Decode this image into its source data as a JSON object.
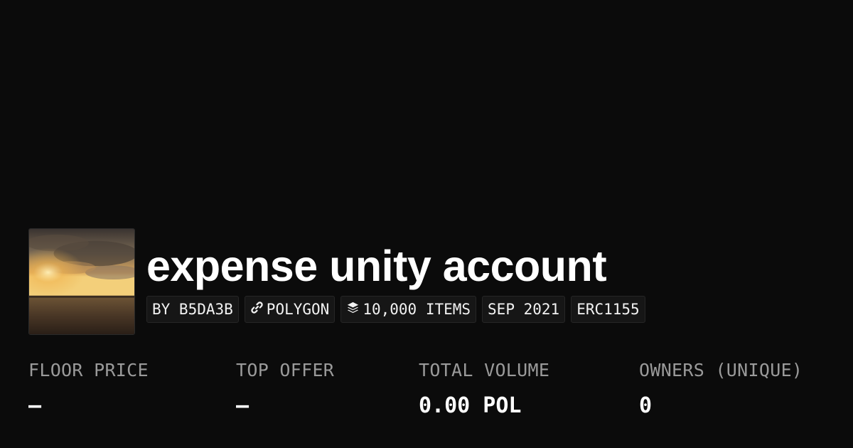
{
  "collection": {
    "image_icon": "sunset-field-thumbnail",
    "title": "expense unity account"
  },
  "badges": {
    "creator": "BY B5DA3B",
    "chain_icon": "polygon-link-icon",
    "chain": "POLYGON",
    "items_icon": "layers-stack-icon",
    "items": "10,000 ITEMS",
    "date": "SEP 2021",
    "standard": "ERC1155"
  },
  "stats": {
    "floor_price": {
      "label": "FLOOR PRICE",
      "value": "–"
    },
    "top_offer": {
      "label": "TOP OFFER",
      "value": "–"
    },
    "total_volume": {
      "label": "TOTAL VOLUME",
      "value": "0.00 POL"
    },
    "owners": {
      "label": "OWNERS (UNIQUE)",
      "value": "0"
    }
  },
  "colors": {
    "background": "#0b0b0b",
    "badge_background": "#161616",
    "label_gray": "#9a9a9a",
    "text": "#ffffff"
  }
}
